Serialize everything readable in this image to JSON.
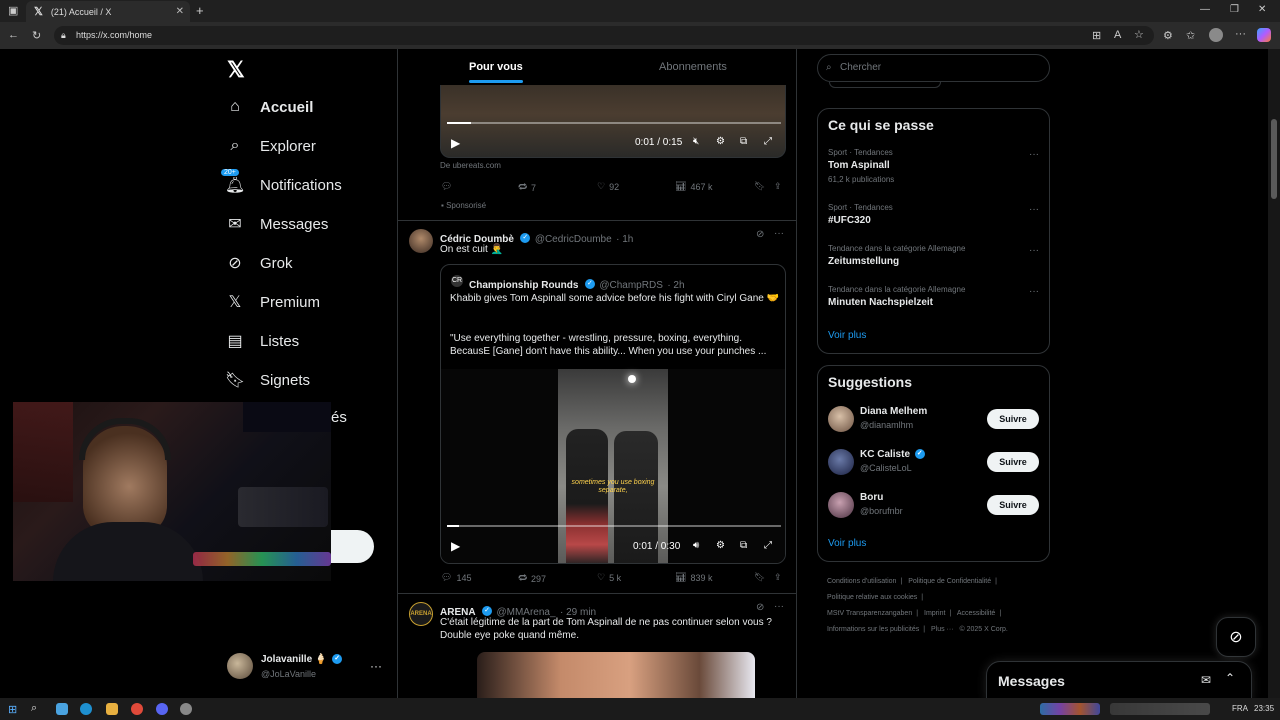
{
  "browser": {
    "tab_title": "(21) Accueil / X",
    "url": "https://x.com/home",
    "tab_icon": "x-logo"
  },
  "nav": {
    "items": [
      {
        "label": "Accueil",
        "icon": "home-icon"
      },
      {
        "label": "Explorer",
        "icon": "search-icon"
      },
      {
        "label": "Notifications",
        "icon": "bell-icon",
        "badge": "20+"
      },
      {
        "label": "Messages",
        "icon": "envelope-icon"
      },
      {
        "label": "Grok",
        "icon": "grok-icon"
      },
      {
        "label": "Premium",
        "icon": "x-icon"
      },
      {
        "label": "Listes",
        "icon": "list-icon"
      },
      {
        "label": "Signets",
        "icon": "bookmark-icon"
      },
      {
        "label": "és"
      }
    ],
    "account_name": "Jolavanille",
    "account_emoji": "🍦",
    "account_handle": "@JoLaVanille"
  },
  "feed": {
    "tabs": [
      "Pour vous",
      "Abonnements"
    ],
    "ad": {
      "video_time": "0:01 / 0:15",
      "source": "De ubereats.com",
      "reposts": "7",
      "likes": "92",
      "views": "467 k",
      "sponsored": "Sponsorisé"
    },
    "tweet1": {
      "name": "Cédric Doumbè",
      "handle": "@CedricDoumbe",
      "time": "· 1h",
      "text": "On est cuit 🤦‍♂️",
      "quote": {
        "name": "Championship Rounds",
        "handle": "@ChampRDS",
        "time": "· 2h",
        "text1": "Khabib gives Tom Aspinall some advice before his fight with Ciryl Gane 🤝",
        "text2": "\"Use everything together - wrestling, pressure, boxing, everything. BecausE [Gane] don't have this ability... When you use your punches ...",
        "caption": "sometimes you use boxing separate,",
        "video_time": "0:01 / 0:30"
      },
      "replies": "145",
      "reposts": "297",
      "likes": "5 k",
      "views": "839 k"
    },
    "tweet2": {
      "name": "ARENA",
      "handle": "@MMArena_",
      "time": "· 29 min",
      "text": "C'était légitime de la part de Tom Aspinall de ne pas continuer selon vous ? Double eye poke quand même."
    }
  },
  "right": {
    "search_placeholder": "Chercher",
    "trends_title": "Ce qui se passe",
    "trends": [
      {
        "meta": "Sport · Tendances",
        "name": "Tom Aspinall",
        "count": "61,2 k publications"
      },
      {
        "meta": "Sport · Tendances",
        "name": "#UFC320",
        "count": ""
      },
      {
        "meta": "Tendance dans la catégorie Allemagne",
        "name": "Zeitumstellung",
        "count": ""
      },
      {
        "meta": "Tendance dans la catégorie Allemagne",
        "name": "Minuten Nachspielzeit",
        "count": ""
      }
    ],
    "show_more": "Voir plus",
    "suggestions_title": "Suggestions",
    "suggestions": [
      {
        "name": "Diana Melhem",
        "handle": "@dianamlhm",
        "verified": false
      },
      {
        "name": "KC Caliste",
        "handle": "@CalisteLoL",
        "verified": true
      },
      {
        "name": "Boru",
        "handle": "@borufnbr",
        "verified": false
      }
    ],
    "follow_label": "Suivre",
    "footer": [
      "Conditions d'utilisation",
      "|",
      "Politique de Confidentialité",
      "|",
      "Politique relative aux cookies",
      "|",
      "MStV Transparenzangaben",
      "|",
      "Imprint",
      "|",
      "Accessibilité",
      "|",
      "Informations sur les publicités",
      "|",
      "Plus ···",
      "© 2025 X Corp."
    ]
  },
  "messages_drawer": {
    "title": "Messages"
  },
  "taskbar": {
    "lang": "FRA",
    "time": "23:35"
  },
  "colors": {
    "accent": "#1d9bf0",
    "bg": "#000000",
    "border": "#2f3336"
  }
}
